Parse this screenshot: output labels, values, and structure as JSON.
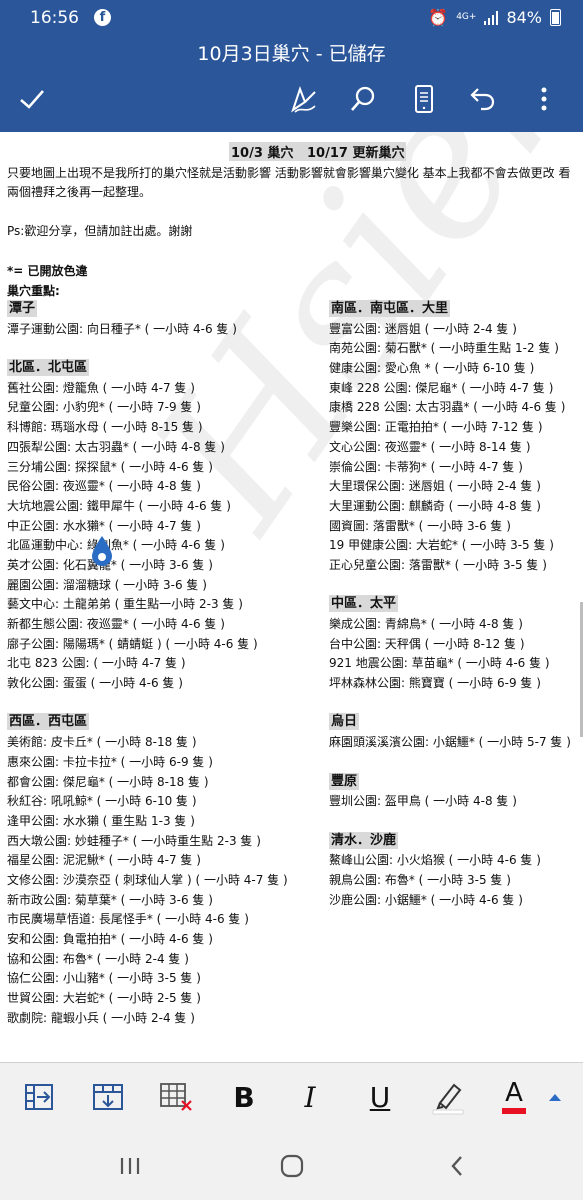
{
  "status_bar": {
    "time": "16:56",
    "network": "4G+",
    "battery": "84%"
  },
  "title_bar": {
    "title": "10月3日巢穴 - 已儲存"
  },
  "document": {
    "header": "10/3 巢穴   10/17 更新巢穴",
    "intro_line1": "只要地圖上出現不是我所打的巢穴怪就是活動影響  活動影響就會影響巢穴變化  基本上我都不會去做更改  看",
    "intro_line2": "兩個禮拜之後再一起整理。",
    "ps": "Ps:歡迎分享，但請加註出處。謝謝",
    "legend": "*=  已開放色違",
    "focus": "巢穴重點:",
    "left_sections": [
      {
        "title": "潭子",
        "entries": [
          "潭子運動公園: 向日種子*  ( 一小時 4-6 隻 )"
        ]
      },
      {
        "title": "北區．北屯區",
        "entries": [
          "舊社公園: 燈籠魚  ( 一小時 4-7 隻 )",
          "兒童公園: 小豹兜* ( 一小時 7-9 隻 )",
          "科博館: 瑪瑙水母 ( 一小時 8-15 隻 )",
          "四張犁公園: 太古羽蟲* ( 一小時 4-8 隻 )",
          "三分埔公園: 探探鼠* ( 一小時 4-6 隻 )",
          "民俗公園: 夜巡靈* ( 一小時 4-8 隻 )",
          "大坑地震公園: 鐵甲犀牛  ( 一小時 4-6 隻 )",
          "中正公園: 水水獺* ( 一小時 4-7 隻 )",
          "北區運動中心: 綠刺魚* ( 一小時 4-6 隻 )",
          "英才公園: 化石翼龍*  ( 一小時 3-6 隻 )",
          "麗園公園: 溜溜糖球 ( 一小時 3-6 隻 )",
          "藝文中心: 土龍弟弟 ( 重生點一小時 2-3 隻 )",
          "新都生態公園: 夜巡靈*  ( 一小時 4-6 隻 )",
          "廍子公園: 陽陽瑪* ( 蜻蜻蜓 ) ( 一小時 4-6 隻 )",
          "北屯 823 公園:  ( 一小時 4-7 隻 )",
          "敦化公園: 蛋蛋 ( 一小時 4-6 隻 )"
        ]
      },
      {
        "title": "西區．西屯區",
        "entries": [
          "美術館: 皮卡丘*  ( 一小時 8-18 隻 )",
          "惠來公園: 卡拉卡拉*  ( 一小時 6-9 隻 )",
          "都會公園: 傑尼龜* ( 一小時 8-18 隻 )",
          "秋紅谷: 吼吼鯨* ( 一小時 6-10 隻 )",
          "逢甲公園: 水水獺 ( 重生點 1-3 隻 )",
          "西大墩公園: 妙蛙種子*  ( 一小時重生點 2-3 隻 )",
          "福星公園: 泥泥鰍*  ( 一小時 4-7 隻 )",
          "文修公園: 沙漠奈亞 (  刺球仙人掌 )  ( 一小時 4-7 隻 )",
          "新市政公園: 菊草葉* ( 一小時 3-6 隻 )",
          "市民廣場草悟道: 長尾怪手* ( 一小時 4-6 隻 )",
          "安和公園: 負電拍拍* ( 一小時 4-6 隻 )",
          "協和公園: 布魯*  ( 一小時 2-4 隻 )",
          "協仁公園: 小山豬* ( 一小時 3-5 隻 )",
          "世貿公園: 大岩蛇* ( 一小時 2-5 隻 )",
          "歌劇院: 龍蝦小兵  ( 一小時 2-4 隻 )"
        ]
      }
    ],
    "right_sections": [
      {
        "title": "南區．南屯區．大里",
        "entries": [
          "豐富公園: 迷唇姐 ( 一小時 2-4 隻 )",
          "南苑公園: 菊石獸* ( 一小時重生點 1-2 隻 )",
          "健康公園: 愛心魚  * ( 一小時 6-10 隻 )",
          "東峰 228 公園: 傑尼龜* ( 一小時 4-7 隻 )",
          "康橋 228 公園: 太古羽蟲*  ( 一小時 4-6 隻 )",
          "豐樂公園: 正電拍拍* ( 一小時 7-12 隻 )",
          "文心公園: 夜巡靈* ( 一小時 8-14 隻 )",
          "崇倫公園: 卡蒂狗*  ( 一小時 4-7 隻 )",
          "大里環保公園: 迷唇姐 ( 一小時 2-4 隻 )",
          "大里運動公園: 麒麟奇 ( 一小時 4-8 隻 )",
          "國資圖: 落雷獸*  ( 一小時 3-6 隻 )",
          "19 甲健康公園:   大岩蛇* ( 一小時 3-5 隻 )",
          "正心兒童公園:   落雷獸* ( 一小時 3-5 隻 )"
        ]
      },
      {
        "title": "中區．太平",
        "entries": [
          "樂成公園: 青綿鳥* ( 一小時 4-8 隻 )",
          "台中公園: 天秤偶  ( 一小時 8-12 隻 )",
          "921 地震公園: 草苗龜* ( 一小時 4-6 隻 )",
          "坪林森林公園: 熊寶寶 ( 一小時 6-9 隻 )"
        ]
      },
      {
        "title": "烏日",
        "entries": [
          "麻園頭溪溪濱公園: 小鋸鱷* ( 一小時 5-7 隻 )"
        ]
      },
      {
        "title": "豐原",
        "entries": [
          "豐圳公園: 盔甲鳥  ( 一小時 4-8 隻 )"
        ]
      },
      {
        "title": "清水．沙鹿",
        "entries": [
          "鰲峰山公園: 小火焰猴  ( 一小時 4-6 隻 )",
          "親鳥公園: 布魯* ( 一小時 3-5 隻 )",
          "沙鹿公園: 小鋸鱷* ( 一小時 4-6 隻 )"
        ]
      }
    ]
  },
  "toolbar": {
    "bold_label": "B",
    "italic_label": "I",
    "underline_label": "U",
    "font_color_label": "A",
    "highlight_color": "#ffffff",
    "font_color": "#e81123"
  },
  "colors": {
    "brand": "#2b579a"
  },
  "icons": [
    "checkmark-icon",
    "draw-pen-icon",
    "search-icon",
    "mobile-view-icon",
    "undo-icon",
    "more-vertical-icon",
    "insert-column-right-icon",
    "insert-row-below-icon",
    "delete-table-icon",
    "highlighter-icon",
    "expand-up-icon",
    "recent-apps-icon",
    "home-icon",
    "back-icon"
  ]
}
